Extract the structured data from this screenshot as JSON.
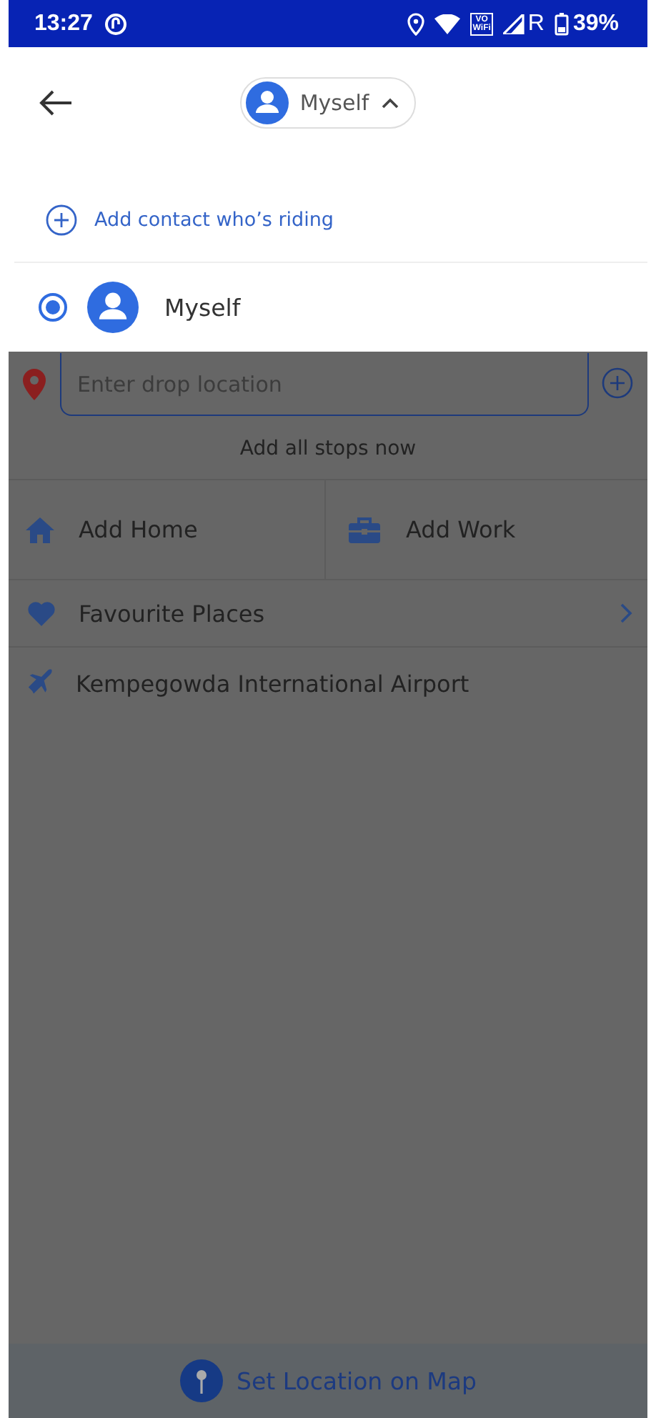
{
  "status_bar": {
    "time": "13:27",
    "vo_wifi": {
      "top": "VO",
      "bottom": "WiFi"
    },
    "network": "R",
    "battery": "39%"
  },
  "header": {
    "rider_chip": {
      "label": "Myself",
      "expanded": true
    }
  },
  "rider_sheet": {
    "add_contact": "Add contact who’s riding",
    "riders": [
      {
        "name": "Myself",
        "selected": true
      }
    ]
  },
  "drop_field": {
    "placeholder": "Enter drop location"
  },
  "add_stops": "Add all stops now",
  "shortcuts": [
    {
      "kind": "home",
      "label": "Add Home"
    },
    {
      "kind": "work",
      "label": "Add Work"
    }
  ],
  "favourites": "Favourite Places",
  "suggestions": [
    {
      "kind": "airport",
      "label": "Kempegowda International Airport"
    }
  ],
  "set_location": "Set Location on Map"
}
